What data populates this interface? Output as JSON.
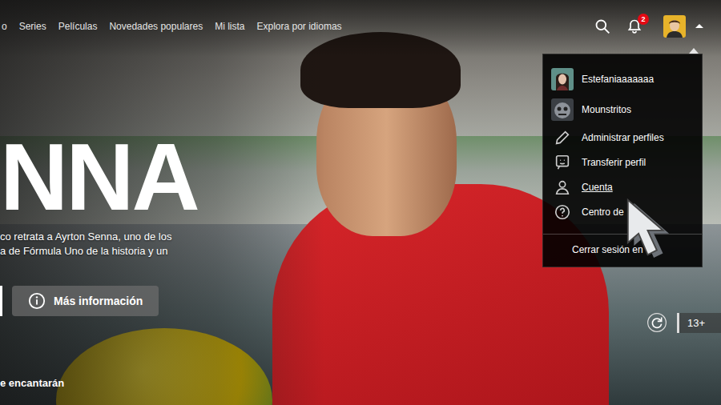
{
  "nav": {
    "links": [
      {
        "label": "o"
      },
      {
        "label": "Series"
      },
      {
        "label": "Películas"
      },
      {
        "label": "Novedades populares"
      },
      {
        "label": "Mi lista"
      },
      {
        "label": "Explora por idiomas"
      }
    ]
  },
  "notifications": {
    "count": "2"
  },
  "profile_menu": {
    "open": true,
    "profiles": [
      {
        "name": "Estefaniaaaaaaa"
      },
      {
        "name": "Mounstritos"
      }
    ],
    "items": [
      {
        "label": "Administrar perfiles",
        "hovered": false
      },
      {
        "label": "Transferir perfil",
        "hovered": false
      },
      {
        "label": "Cuenta",
        "hovered": true
      },
      {
        "label": "Centro de",
        "hovered": false
      }
    ],
    "sign_out": "Cerrar sesión en"
  },
  "hero": {
    "title": "NNA",
    "synopsis": [
      "co retrata a Ayrton Senna, uno de los",
      "a de Fórmula Uno de la historia y un"
    ],
    "info_button": "Más información",
    "rating": "13+"
  },
  "row": {
    "title": "e encantarán"
  }
}
